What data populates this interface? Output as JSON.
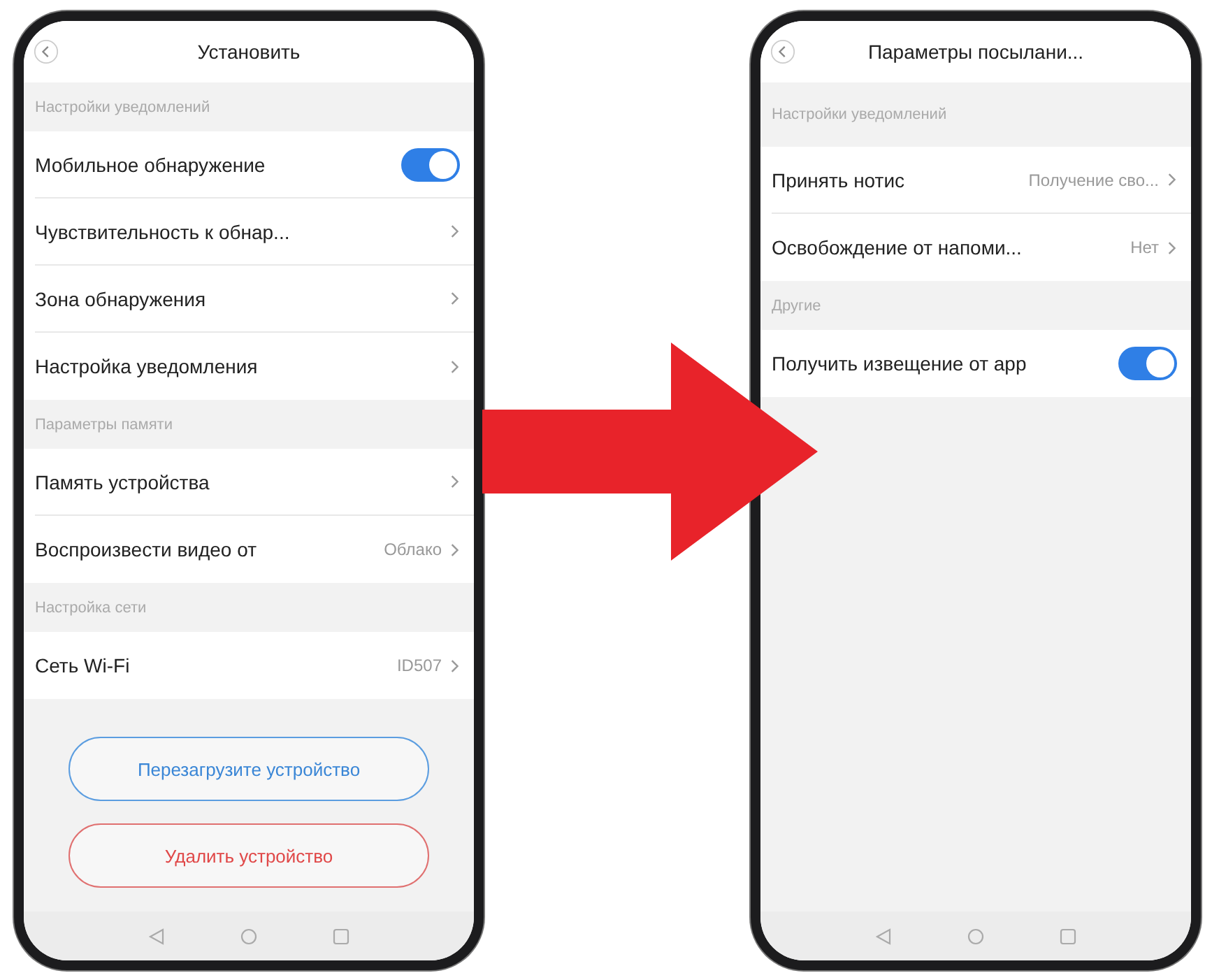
{
  "screens": [
    {
      "title": "Установить",
      "sections": [
        {
          "heading": "Настройки уведомлений",
          "rows": [
            {
              "kind": "toggle",
              "label": "Мобильное обнаружение",
              "on": true
            },
            {
              "kind": "link",
              "label": "Чувствительность к обнар..."
            },
            {
              "kind": "link",
              "label": "Зона обнаружения"
            },
            {
              "kind": "link",
              "label": "Настройка уведомления"
            }
          ]
        },
        {
          "heading": "Параметры памяти",
          "rows": [
            {
              "kind": "link",
              "label": "Память устройства"
            },
            {
              "kind": "link",
              "label": "Воспроизвести видео от",
              "value": "Облако"
            }
          ]
        },
        {
          "heading": "Настройка сети",
          "rows": [
            {
              "kind": "link",
              "label": "Сеть Wi-Fi",
              "value": "ID507"
            }
          ]
        }
      ],
      "buttons": [
        {
          "kind": "primary",
          "label": "Перезагрузите устройство"
        },
        {
          "kind": "danger",
          "label": "Удалить устройство"
        }
      ]
    },
    {
      "title": "Параметры посылани...",
      "sections": [
        {
          "heading": "Настройки уведомлений",
          "rows": [
            {
              "kind": "link",
              "label": "Принять нотис",
              "value": "Получение сво..."
            },
            {
              "kind": "link",
              "label": "Освобождение от напоми...",
              "value": "Нет"
            }
          ]
        },
        {
          "heading": "Другие",
          "rows": [
            {
              "kind": "toggle",
              "label": "Получить извещение от app",
              "on": true
            }
          ]
        }
      ]
    }
  ]
}
